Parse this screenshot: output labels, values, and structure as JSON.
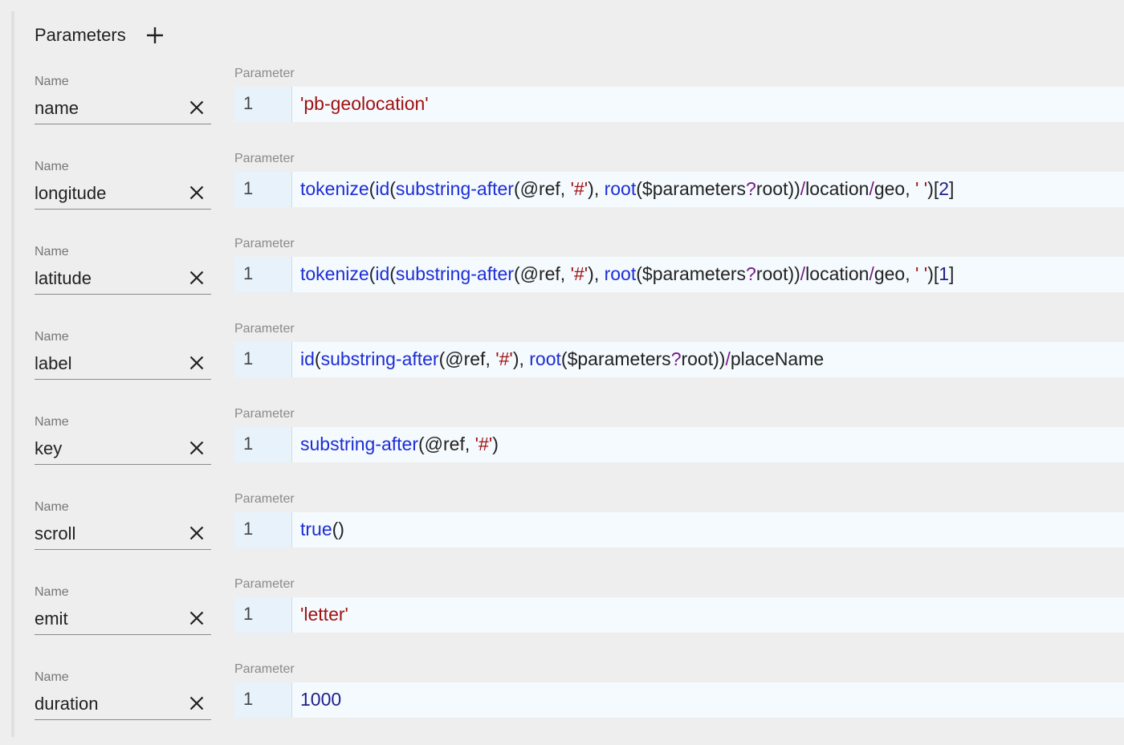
{
  "header": {
    "title": "Parameters",
    "add_icon": "plus-icon"
  },
  "labels": {
    "name": "Name",
    "parameter": "Parameter"
  },
  "colors": {
    "background": "#eeeeee",
    "editor_background": "#f4fafe",
    "gutter_background": "#e7f2fb",
    "function": "#1d2dd6",
    "string": "#a11111",
    "operator": "#7a1a86",
    "number": "#1f1f8a"
  },
  "parameters": [
    {
      "name": "name",
      "line": "1",
      "tokens": [
        {
          "t": "'pb-geolocation'",
          "k": "str"
        }
      ]
    },
    {
      "name": "longitude",
      "line": "1",
      "tokens": [
        {
          "t": "tokenize",
          "k": "fn"
        },
        {
          "t": "(",
          "k": "plain"
        },
        {
          "t": "id",
          "k": "fn"
        },
        {
          "t": "(",
          "k": "plain"
        },
        {
          "t": "substring-after",
          "k": "fn"
        },
        {
          "t": "(@ref, ",
          "k": "plain"
        },
        {
          "t": "'#'",
          "k": "str"
        },
        {
          "t": "), ",
          "k": "plain"
        },
        {
          "t": "root",
          "k": "fn"
        },
        {
          "t": "($parameters",
          "k": "plain"
        },
        {
          "t": "?",
          "k": "op"
        },
        {
          "t": "root))",
          "k": "plain"
        },
        {
          "t": "/",
          "k": "op"
        },
        {
          "t": "location",
          "k": "plain"
        },
        {
          "t": "/",
          "k": "op"
        },
        {
          "t": "geo, ",
          "k": "plain"
        },
        {
          "t": "' '",
          "k": "str"
        },
        {
          "t": ")[",
          "k": "plain"
        },
        {
          "t": "2",
          "k": "num"
        },
        {
          "t": "]",
          "k": "plain"
        }
      ]
    },
    {
      "name": "latitude",
      "line": "1",
      "tokens": [
        {
          "t": "tokenize",
          "k": "fn"
        },
        {
          "t": "(",
          "k": "plain"
        },
        {
          "t": "id",
          "k": "fn"
        },
        {
          "t": "(",
          "k": "plain"
        },
        {
          "t": "substring-after",
          "k": "fn"
        },
        {
          "t": "(@ref, ",
          "k": "plain"
        },
        {
          "t": "'#'",
          "k": "str"
        },
        {
          "t": "), ",
          "k": "plain"
        },
        {
          "t": "root",
          "k": "fn"
        },
        {
          "t": "($parameters",
          "k": "plain"
        },
        {
          "t": "?",
          "k": "op"
        },
        {
          "t": "root))",
          "k": "plain"
        },
        {
          "t": "/",
          "k": "op"
        },
        {
          "t": "location",
          "k": "plain"
        },
        {
          "t": "/",
          "k": "op"
        },
        {
          "t": "geo, ",
          "k": "plain"
        },
        {
          "t": "' '",
          "k": "str"
        },
        {
          "t": ")[",
          "k": "plain"
        },
        {
          "t": "1",
          "k": "num"
        },
        {
          "t": "]",
          "k": "plain"
        }
      ]
    },
    {
      "name": "label",
      "line": "1",
      "tokens": [
        {
          "t": "id",
          "k": "fn"
        },
        {
          "t": "(",
          "k": "plain"
        },
        {
          "t": "substring-after",
          "k": "fn"
        },
        {
          "t": "(@ref, ",
          "k": "plain"
        },
        {
          "t": "'#'",
          "k": "str"
        },
        {
          "t": "), ",
          "k": "plain"
        },
        {
          "t": "root",
          "k": "fn"
        },
        {
          "t": "($parameters",
          "k": "plain"
        },
        {
          "t": "?",
          "k": "op"
        },
        {
          "t": "root))",
          "k": "plain"
        },
        {
          "t": "/",
          "k": "op"
        },
        {
          "t": "placeName",
          "k": "plain"
        }
      ]
    },
    {
      "name": "key",
      "line": "1",
      "tokens": [
        {
          "t": "substring-after",
          "k": "fn"
        },
        {
          "t": "(@ref, ",
          "k": "plain"
        },
        {
          "t": "'#'",
          "k": "str"
        },
        {
          "t": ")",
          "k": "plain"
        }
      ]
    },
    {
      "name": "scroll",
      "line": "1",
      "tokens": [
        {
          "t": "true",
          "k": "fn"
        },
        {
          "t": "()",
          "k": "plain"
        }
      ]
    },
    {
      "name": "emit",
      "line": "1",
      "tokens": [
        {
          "t": "'letter'",
          "k": "str"
        }
      ]
    },
    {
      "name": "duration",
      "line": "1",
      "tokens": [
        {
          "t": "1000",
          "k": "num"
        }
      ]
    }
  ]
}
